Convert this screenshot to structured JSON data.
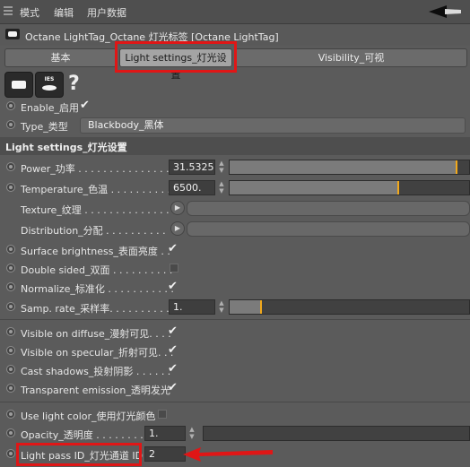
{
  "menu": {
    "items": [
      "模式",
      "编辑",
      "用户数据"
    ]
  },
  "tag": {
    "title": "Octane LightTag_Octane 灯光标签 [Octane LightTag]"
  },
  "tabs": [
    {
      "label": "基本",
      "active": false
    },
    {
      "label": "Light settings_灯光设置",
      "active": true
    },
    {
      "label": "Visibility_可视",
      "active": false
    }
  ],
  "icons": {
    "light": "area-light-icon",
    "ies": "ies-icon",
    "ies_text": "IES",
    "help": "?"
  },
  "enable": {
    "label": "Enable_启用 ",
    "checked": true
  },
  "type": {
    "label": "Type_类型",
    "value": "Blackbody_黑体"
  },
  "section_title": "Light settings_灯光设置",
  "power": {
    "label": "Power_功率 . . . . . . . . . . . . . . .",
    "value": "31.53256",
    "slider_fraction": 0.96
  },
  "temperature": {
    "label": "Temperature_色温 . . . . . . . . . .",
    "value": "6500.",
    "slider_fraction": 0.71
  },
  "texture": {
    "label": "Texture_纹理 . . . . . . . . . . . . . ."
  },
  "distribution": {
    "label": "Distribution_分配 . . . . . . . . . ."
  },
  "surface_brightness": {
    "label": "Surface brightness_表面亮度 . .",
    "checked": true
  },
  "double_sided": {
    "label": "Double sided_双面 . . . . . . . . . .",
    "checked": false
  },
  "normalize": {
    "label": "Normalize_标准化 . . . . . . . . . . .",
    "checked": true
  },
  "samp_rate": {
    "label": "Samp. rate_采样率. . . . . . . . . . .",
    "value": "1.",
    "slider_fraction": 0.13
  },
  "visible_diffuse": {
    "label": "Visible on diffuse_漫射可见. . . .",
    "checked": true
  },
  "visible_specular": {
    "label": "Visible on specular_折射可见. . .",
    "checked": true
  },
  "cast_shadows": {
    "label": "Cast shadows_投射阴影 . . . . . .",
    "checked": true
  },
  "transparent_emission": {
    "label": "Transparent emission_透明发光",
    "checked": true
  },
  "use_light_color": {
    "label": "Use light color_使用灯光颜色",
    "checked": false
  },
  "opacity": {
    "label": "Opacity_透明度 . . . . . . . . . . . .",
    "value": "1."
  },
  "light_pass_id": {
    "label": "Light pass ID_灯光通道 ID",
    "value": "2"
  },
  "colors": {
    "highlight": "#e01616",
    "slider_marker": "#f1a81b",
    "active_tab": "#a4a4a4"
  }
}
